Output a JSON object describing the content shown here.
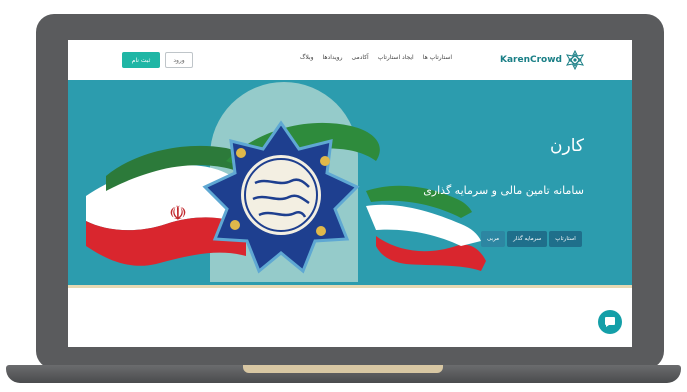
{
  "header": {
    "signup_label": "ثبت نام",
    "login_label": "ورود",
    "nav": [
      "استارتاپ ها",
      "ایجاد استارتاپ",
      "آکادمی",
      "رویدادها",
      "وبلاگ"
    ],
    "logo_text": "KarenCrowd"
  },
  "hero": {
    "title": "کارن",
    "subtitle": "سامانه تامین مالی و سرمایه گذاری",
    "buttons": [
      "استارتاپ",
      "سرمایه گذار",
      "مربی"
    ]
  },
  "colors": {
    "accent": "#1fb6a5",
    "hero_bg": "#2c9cae",
    "chat_button": "#149fa8"
  },
  "icons": {
    "logo": "star-pattern-icon",
    "chat": "chat-bubble-icon"
  }
}
